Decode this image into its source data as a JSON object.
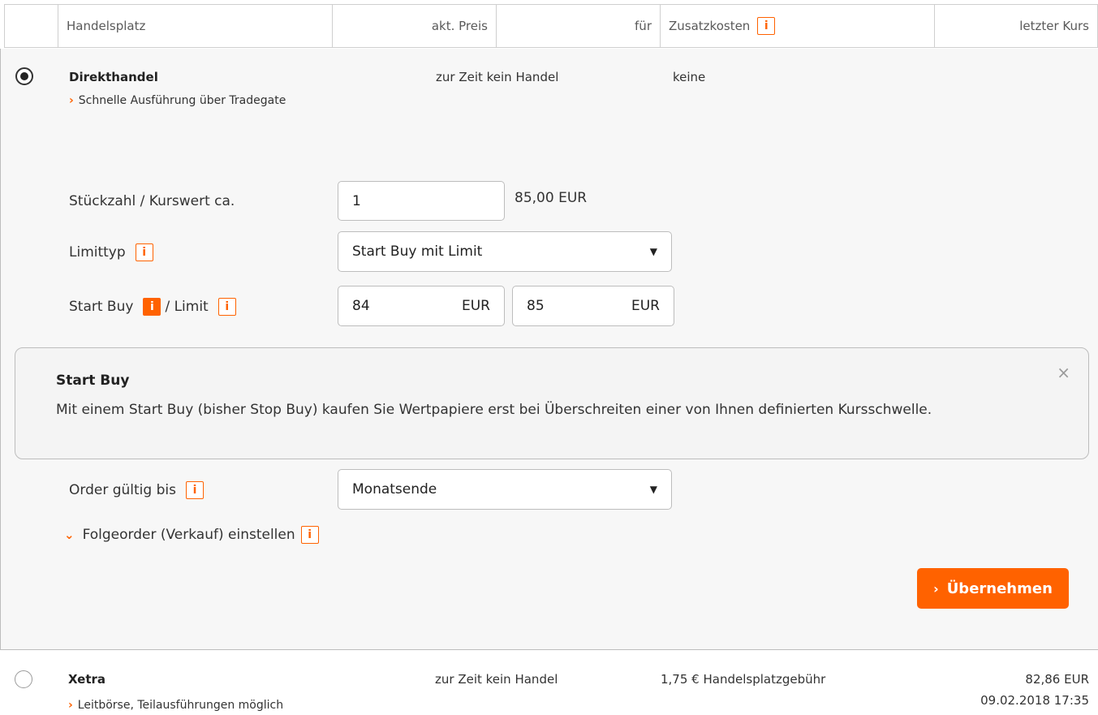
{
  "header": {
    "handelsplatz": "Handelsplatz",
    "akt_preis": "akt. Preis",
    "fuer": "für",
    "zusatzkosten": "Zusatzkosten",
    "letzter_kurs": "letzter Kurs",
    "info_glyph": "i"
  },
  "direkthandel": {
    "name": "Direkthandel",
    "sub": "Schnelle Ausführung über Tradegate",
    "price": "zur Zeit kein Handel",
    "costs": "keine"
  },
  "form": {
    "stueckzahl_label": "Stückzahl / Kurswert ca.",
    "stueckzahl_value": "1",
    "kurswert": "85,00 EUR",
    "limittyp_label": "Limittyp",
    "limittyp_value": "Start Buy mit Limit",
    "startbuy_label": "Start Buy",
    "limit_label": "/ Limit",
    "startbuy_value": "84",
    "limit_value": "85",
    "currency": "EUR",
    "order_label": "Order gültig bis",
    "order_value": "Monatsende",
    "folgeorder": "Folgeorder (Verkauf) einstellen",
    "submit": "Übernehmen"
  },
  "info_panel": {
    "title": "Start Buy",
    "text": "Mit einem Start Buy (bisher Stop Buy) kaufen Sie Wertpapiere erst bei Überschreiten einer von Ihnen definierten Kursschwelle.",
    "close": "×"
  },
  "xetra": {
    "name": "Xetra",
    "sub": "Leitbörse, Teilausführungen möglich",
    "price": "zur Zeit kein Handel",
    "costs": "1,75 € Handelsplatzgebühr",
    "last_price": "82,86 EUR",
    "last_time": "09.02.2018 17:35"
  },
  "colors": {
    "accent": "#ff6200"
  }
}
